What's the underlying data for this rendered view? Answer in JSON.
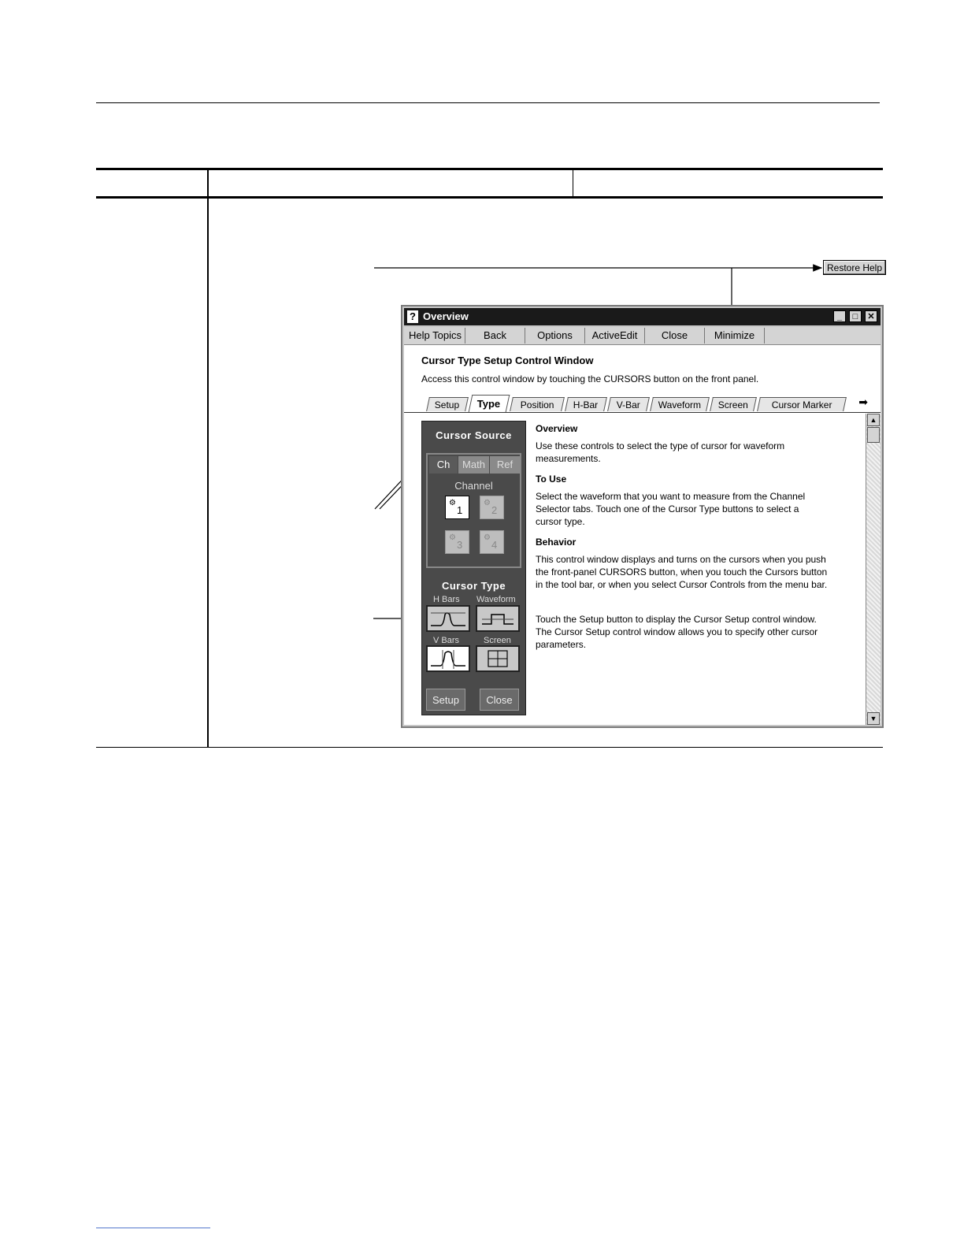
{
  "restore_help": "Restore Help",
  "window": {
    "title": "Overview",
    "menu": [
      "Help Topics",
      "Back",
      "Options",
      "ActiveEdit",
      "Close",
      "Minimize"
    ],
    "heading": "Cursor Type Setup Control Window",
    "access_text": "Access this control window by touching the CURSORS button on the front panel.",
    "tabs": [
      "Setup",
      "Type",
      "Position",
      "H-Bar",
      "V-Bar",
      "Waveform",
      "Screen",
      "Cursor Marker"
    ],
    "active_tab": "Type"
  },
  "panel": {
    "source_title": "Cursor Source",
    "source_tabs": [
      "Ch",
      "Math",
      "Ref"
    ],
    "channel_label": "Channel",
    "channels": [
      "1",
      "2",
      "3",
      "4"
    ],
    "type_title": "Cursor Type",
    "types": [
      "H Bars",
      "Waveform",
      "V Bars",
      "Screen"
    ],
    "setup_button": "Setup",
    "close_button": "Close"
  },
  "help": {
    "overview_title": "Overview",
    "overview_text": "Use these controls to select the type of cursor for waveform measurements.",
    "touse_title": "To Use",
    "touse_text": "Select the waveform that you want to measure from the Channel Selector tabs. Touch one of the Cursor Type buttons to select a cursor type.",
    "behavior_title": "Behavior",
    "behavior_text": "This control window displays and turns on the cursors when you push the front-panel CURSORS button, when you touch the Cursors button in the tool bar, or when you select Cursor Controls from the menu bar.",
    "setup_text": "Touch the Setup button to display the Cursor Setup control window. The Cursor Setup control window allows you to specify other cursor parameters."
  },
  "icons": {
    "help": "help-question-icon",
    "minimize": "minimize-icon",
    "maximize": "maximize-icon",
    "close": "close-icon",
    "more_tabs": "arrow-right-icon",
    "scroll_up": "scroll-up-icon",
    "scroll_down": "scroll-down-icon"
  }
}
